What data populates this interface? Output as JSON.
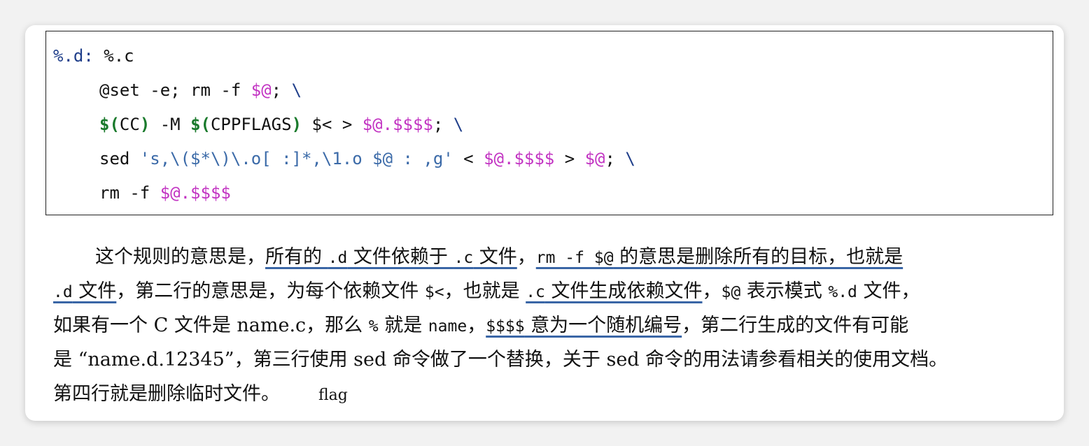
{
  "code": {
    "l1_a": "%.d",
    "l1_b": ":",
    "l1_c": " %.c",
    "l2_a": "@set -e; rm -f ",
    "l2_b": "$@",
    "l2_c": "; ",
    "l2_d": "\\",
    "l3_a": "$(",
    "l3_b": "CC",
    "l3_c": ")",
    "l3_d": " -M ",
    "l3_e": "$(",
    "l3_f": "CPPFLAGS",
    "l3_g": ")",
    "l3_h": " $< > ",
    "l3_i": "$@.$$$$",
    "l3_j": "; ",
    "l3_k": "\\",
    "l4_a": "sed ",
    "l4_b": "'s,\\($*\\)\\.o[ :]*,\\1.o $@ : ,g'",
    "l4_c": " < ",
    "l4_d": "$@.$$$$",
    "l4_e": " > ",
    "l4_f": "$@",
    "l4_g": "; ",
    "l4_h": "\\",
    "l5_a": "rm -f ",
    "l5_b": "$@.$$$$"
  },
  "para": {
    "p1_a": "这个规则的意思是，",
    "p1_b": "所有的 ",
    "p1_c": ".d",
    "p1_d": " 文件依赖于 ",
    "p1_e": ".c",
    "p1_f": " 文件",
    "p1_g": "，",
    "p1_h": "rm -f $@",
    "p1_i": " 的意思是删除所有的目标，也就是",
    "p2_a": ".d",
    "p2_b": " 文件",
    "p2_c": "，第二行的意思是，为每个依赖文件 ",
    "p2_d": "$<",
    "p2_e": "，也就是 ",
    "p2_f": ".c",
    "p2_g": " 文件生成依赖文件",
    "p2_h": "，",
    "p2_i": "$@",
    "p2_j": " 表示模式 ",
    "p2_k": "%.d",
    "p2_l": " 文件，",
    "p3_a": "如果有一个 C 文件是 name.c，那么 ",
    "p3_b": "%",
    "p3_c": " 就是 ",
    "p3_d": "name",
    "p3_e": "，",
    "p3_f": "$$$$",
    "p3_g": " 意为一个随机编号",
    "p3_h": "，第二行生成的文件有可能",
    "p4": "是 “name.d.12345”，第三行使用 sed 命令做了一个替换，关于 sed 命令的用法请参看相关的使用文档。",
    "p5": "第四行就是删除临时文件。",
    "flag": "flag"
  }
}
